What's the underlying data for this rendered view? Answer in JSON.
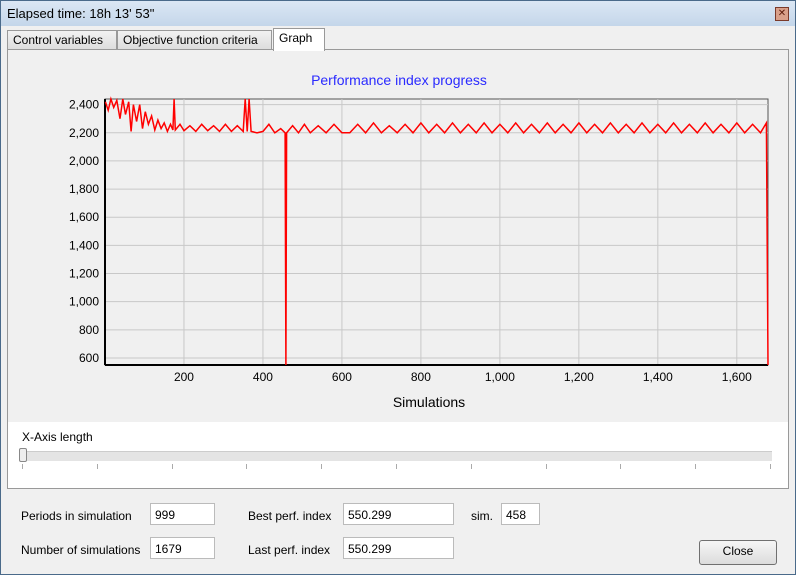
{
  "window": {
    "title": "Elapsed time:  18h 13' 53\""
  },
  "tabs": [
    {
      "label": "Control variables"
    },
    {
      "label": "Objective function criteria"
    },
    {
      "label": "Graph"
    }
  ],
  "chart_data": {
    "type": "line",
    "title": "Performance index progress",
    "xlabel": "Simulations",
    "ylabel": "",
    "xlim": [
      1,
      1679
    ],
    "ylim": [
      550,
      2440
    ],
    "xticks": [
      200,
      400,
      600,
      800,
      1000,
      1200,
      1400,
      1600
    ],
    "xtick_labels": [
      "200",
      "400",
      "600",
      "800",
      "1,000",
      "1,200",
      "1,400",
      "1,600"
    ],
    "yticks": [
      600,
      800,
      1000,
      1200,
      1400,
      1600,
      1800,
      2000,
      2200,
      2400
    ],
    "ytick_labels": [
      "600",
      "800",
      "1,000",
      "1,200",
      "1,400",
      "1,600",
      "1,800",
      "2,000",
      "2,200",
      "2,400"
    ],
    "grid": true,
    "color": "#ff0000",
    "points": [
      [
        1,
        2420
      ],
      [
        8,
        2360
      ],
      [
        15,
        2440
      ],
      [
        22,
        2380
      ],
      [
        30,
        2430
      ],
      [
        38,
        2300
      ],
      [
        45,
        2440
      ],
      [
        52,
        2330
      ],
      [
        60,
        2420
      ],
      [
        66,
        2210
      ],
      [
        72,
        2400
      ],
      [
        80,
        2280
      ],
      [
        88,
        2400
      ],
      [
        95,
        2230
      ],
      [
        102,
        2350
      ],
      [
        110,
        2260
      ],
      [
        118,
        2320
      ],
      [
        126,
        2220
      ],
      [
        134,
        2290
      ],
      [
        142,
        2230
      ],
      [
        150,
        2270
      ],
      [
        158,
        2210
      ],
      [
        166,
        2260
      ],
      [
        172,
        2220
      ],
      [
        175,
        2440
      ],
      [
        178,
        2220
      ],
      [
        190,
        2260
      ],
      [
        200,
        2215
      ],
      [
        215,
        2250
      ],
      [
        230,
        2210
      ],
      [
        245,
        2260
      ],
      [
        260,
        2215
      ],
      [
        275,
        2250
      ],
      [
        290,
        2210
      ],
      [
        305,
        2260
      ],
      [
        320,
        2210
      ],
      [
        335,
        2250
      ],
      [
        350,
        2210
      ],
      [
        355,
        2440
      ],
      [
        360,
        2210
      ],
      [
        365,
        2440
      ],
      [
        370,
        2210
      ],
      [
        385,
        2200
      ],
      [
        400,
        2210
      ],
      [
        415,
        2260
      ],
      [
        430,
        2200
      ],
      [
        445,
        2230
      ],
      [
        456,
        2200
      ],
      [
        458,
        550
      ],
      [
        460,
        2200
      ],
      [
        475,
        2250
      ],
      [
        490,
        2200
      ],
      [
        505,
        2260
      ],
      [
        520,
        2200
      ],
      [
        540,
        2250
      ],
      [
        560,
        2200
      ],
      [
        580,
        2260
      ],
      [
        600,
        2200
      ],
      [
        620,
        2200
      ],
      [
        640,
        2260
      ],
      [
        660,
        2200
      ],
      [
        680,
        2270
      ],
      [
        700,
        2200
      ],
      [
        720,
        2250
      ],
      [
        740,
        2200
      ],
      [
        760,
        2260
      ],
      [
        780,
        2200
      ],
      [
        800,
        2270
      ],
      [
        820,
        2200
      ],
      [
        840,
        2260
      ],
      [
        860,
        2200
      ],
      [
        880,
        2270
      ],
      [
        900,
        2200
      ],
      [
        920,
        2260
      ],
      [
        940,
        2200
      ],
      [
        960,
        2270
      ],
      [
        980,
        2200
      ],
      [
        1000,
        2260
      ],
      [
        1020,
        2200
      ],
      [
        1040,
        2270
      ],
      [
        1060,
        2200
      ],
      [
        1080,
        2260
      ],
      [
        1100,
        2200
      ],
      [
        1120,
        2270
      ],
      [
        1140,
        2200
      ],
      [
        1160,
        2260
      ],
      [
        1180,
        2200
      ],
      [
        1200,
        2270
      ],
      [
        1220,
        2200
      ],
      [
        1240,
        2260
      ],
      [
        1260,
        2200
      ],
      [
        1280,
        2270
      ],
      [
        1300,
        2200
      ],
      [
        1320,
        2260
      ],
      [
        1340,
        2200
      ],
      [
        1360,
        2270
      ],
      [
        1380,
        2200
      ],
      [
        1400,
        2260
      ],
      [
        1420,
        2200
      ],
      [
        1440,
        2270
      ],
      [
        1460,
        2200
      ],
      [
        1480,
        2260
      ],
      [
        1500,
        2200
      ],
      [
        1520,
        2270
      ],
      [
        1540,
        2200
      ],
      [
        1560,
        2260
      ],
      [
        1580,
        2200
      ],
      [
        1600,
        2270
      ],
      [
        1620,
        2200
      ],
      [
        1640,
        2260
      ],
      [
        1660,
        2200
      ],
      [
        1675,
        2270
      ],
      [
        1679,
        550
      ]
    ]
  },
  "slider": {
    "label": "X-Axis length",
    "value": 0
  },
  "fields": {
    "periods_label": "Periods in simulation",
    "periods_value": "999",
    "nsim_label": "Number of simulations",
    "nsim_value": "1679",
    "best_label": "Best perf. index",
    "best_value": "550.299",
    "sim_label": "sim.",
    "sim_value": "458",
    "last_label": "Last perf. index",
    "last_value": "550.299"
  },
  "buttons": {
    "close": "Close"
  }
}
